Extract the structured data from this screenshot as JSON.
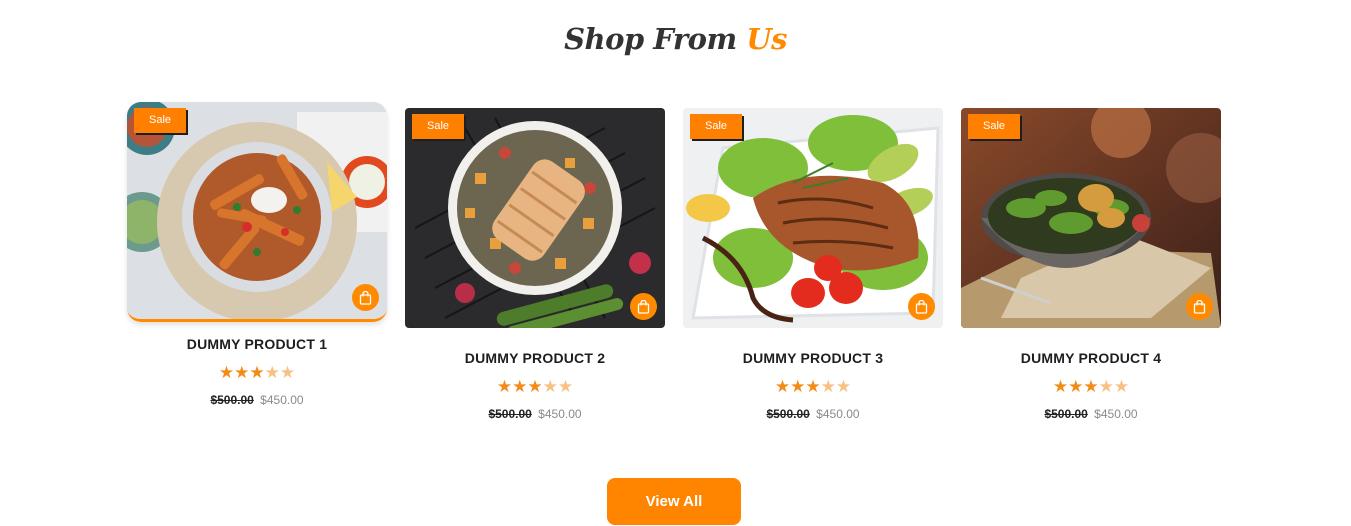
{
  "section": {
    "title_main": "Shop From",
    "title_accent": "Us"
  },
  "products": [
    {
      "badge": "Sale",
      "name": "DUMMY PRODUCT 1",
      "rating": 3,
      "rating_max": 5,
      "old_price": "$500.00",
      "new_price": "$450.00",
      "image_icon": "food-photo-fries-bowl",
      "cart_icon": "shopping-bag-icon"
    },
    {
      "badge": "Sale",
      "name": "DUMMY PRODUCT 2",
      "rating": 3,
      "rating_max": 5,
      "old_price": "$500.00",
      "new_price": "$450.00",
      "image_icon": "food-photo-chicken-bowl",
      "cart_icon": "shopping-bag-icon"
    },
    {
      "badge": "Sale",
      "name": "DUMMY PRODUCT 3",
      "rating": 3,
      "rating_max": 5,
      "old_price": "$500.00",
      "new_price": "$450.00",
      "image_icon": "food-photo-salmon-plate",
      "cart_icon": "shopping-bag-icon"
    },
    {
      "badge": "Sale",
      "name": "DUMMY PRODUCT 4",
      "rating": 3,
      "rating_max": 5,
      "old_price": "$500.00",
      "new_price": "$450.00",
      "image_icon": "food-photo-salad-bowl",
      "cart_icon": "shopping-bag-icon"
    }
  ],
  "cta": {
    "view_all_label": "View All"
  },
  "colors": {
    "accent": "#ff8a00",
    "title": "#333333",
    "price_old": "#222222",
    "price_new": "#8a8a8a"
  }
}
